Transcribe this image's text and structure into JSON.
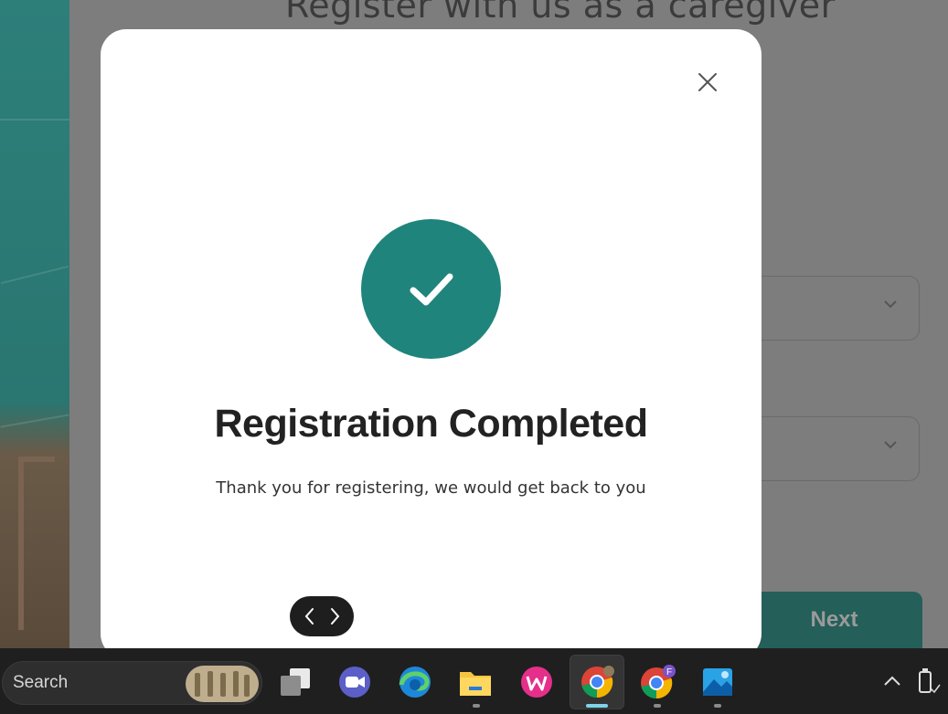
{
  "background": {
    "page_title": "Register with us as a caregiver",
    "next_button_label": "Next"
  },
  "modal": {
    "title": "Registration Completed",
    "subtitle": "Thank you for registering, we would get back to you",
    "accent_color": "#1f847c"
  },
  "taskbar": {
    "search_placeholder": "Search",
    "apps": [
      {
        "name": "task-view",
        "icon": "task-view-icon"
      },
      {
        "name": "video-call",
        "icon": "video-call-icon"
      },
      {
        "name": "edge",
        "icon": "edge-icon"
      },
      {
        "name": "file-explorer",
        "icon": "folder-icon"
      },
      {
        "name": "wps-office",
        "icon": "wps-icon"
      },
      {
        "name": "chrome",
        "icon": "chrome-icon"
      },
      {
        "name": "chrome-profile-f",
        "icon": "chrome-icon",
        "badge": "F"
      },
      {
        "name": "photos",
        "icon": "photos-icon"
      }
    ]
  }
}
